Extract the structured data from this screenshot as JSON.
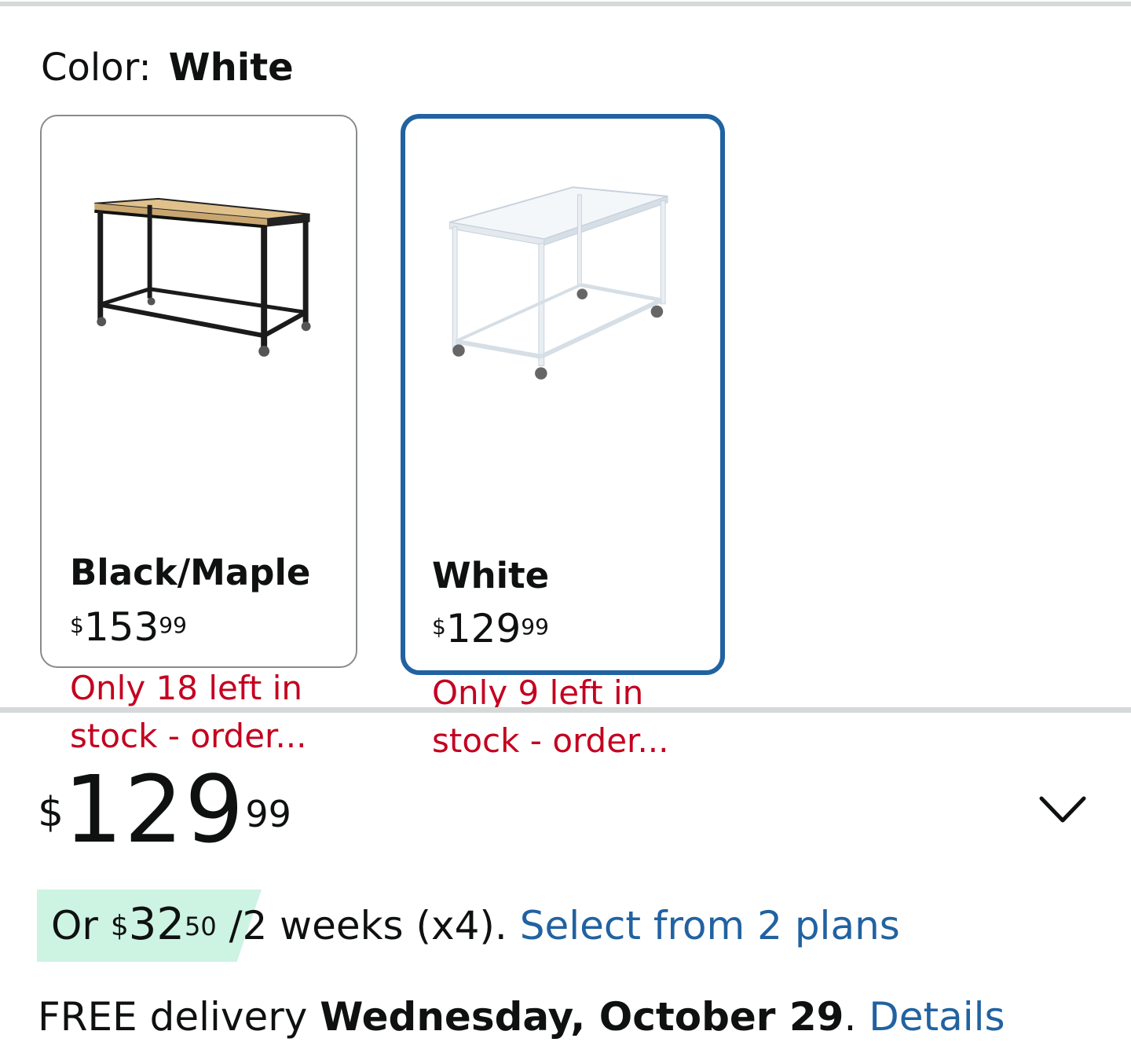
{
  "variation": {
    "label": "Color:",
    "selected_value": "White"
  },
  "swatches": [
    {
      "name": "Black/Maple",
      "price": {
        "currency": "$",
        "whole": "153",
        "fraction": "99"
      },
      "stock_line1": "Only 18 left in",
      "stock_line2": "stock - order...",
      "selected": false,
      "image": "black-maple-desk-image"
    },
    {
      "name": "White",
      "price": {
        "currency": "$",
        "whole": "129",
        "fraction": "99"
      },
      "stock_line1": "Only 9 left in",
      "stock_line2": "stock - order...",
      "selected": true,
      "image": "white-desk-image"
    }
  ],
  "price": {
    "currency": "$",
    "whole": "129",
    "fraction": "99"
  },
  "expand_icon": "chevron-down-icon",
  "installment": {
    "prefix": "Or",
    "currency": "$",
    "whole": "32",
    "fraction": "50",
    "terms": "/2 weeks (x4).",
    "link": "Select from 2 plans"
  },
  "delivery": {
    "prefix": "FREE delivery",
    "date": "Wednesday, October 29",
    "separator": ".",
    "link": "Details"
  },
  "colors": {
    "selected_border": "#2162a1",
    "stock_warning": "#c40020",
    "link": "#2162a1",
    "installment_badge": "#cdf3e3",
    "divider": "#d5d9d9"
  }
}
